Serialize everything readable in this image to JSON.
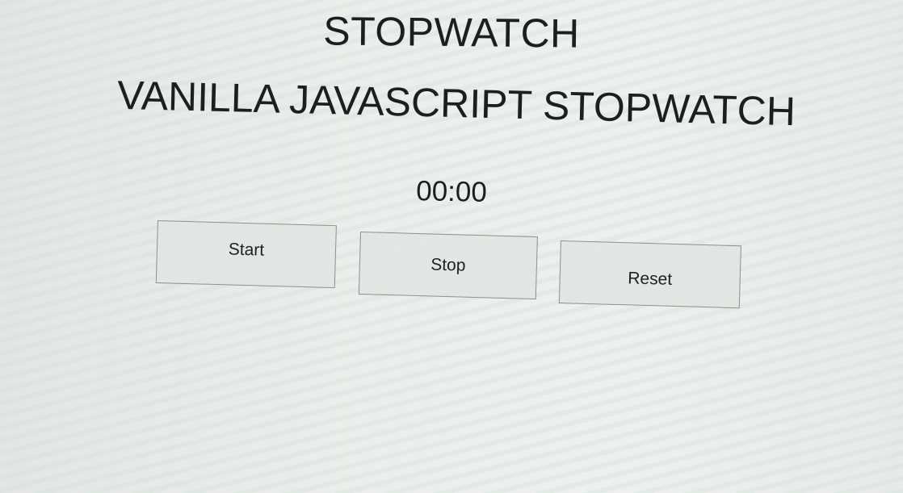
{
  "page": {
    "title": "STOPWATCH",
    "heading": "VANILLA JAVASCRIPT STOPWATCH"
  },
  "stopwatch": {
    "display": "00:00"
  },
  "controls": {
    "start_label": "Start",
    "stop_label": "Stop",
    "reset_label": "Reset"
  }
}
